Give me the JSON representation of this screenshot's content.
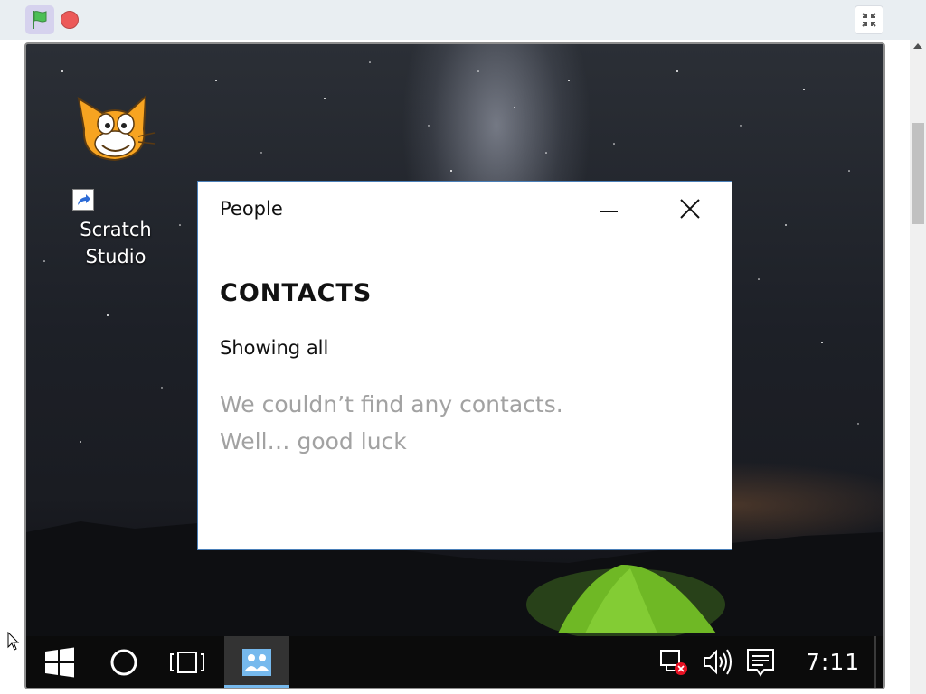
{
  "player": {
    "flag_icon": "green-flag-icon",
    "stop_icon": "stop-icon",
    "fullscreen_icon": "exit-fullscreen-icon"
  },
  "desktop": {
    "icon_label_line1": "Scratch",
    "icon_label_line2": "Studio"
  },
  "window": {
    "title": "People",
    "heading": "CONTACTS",
    "filter": "Showing all",
    "empty_line1": "We couldn’t find any contacts.",
    "empty_line2": "Well… good luck"
  },
  "taskbar": {
    "clock": "7:11",
    "items": [
      "start-icon",
      "cortana-icon",
      "task-view-icon",
      "people-icon"
    ],
    "tray": [
      "network-disconnected-icon",
      "volume-icon",
      "action-center-icon"
    ]
  },
  "colors": {
    "accent": "#76b9ed",
    "window_border": "#4a7fb8",
    "flag": "#4cbf56",
    "stop": "#ec5959"
  }
}
